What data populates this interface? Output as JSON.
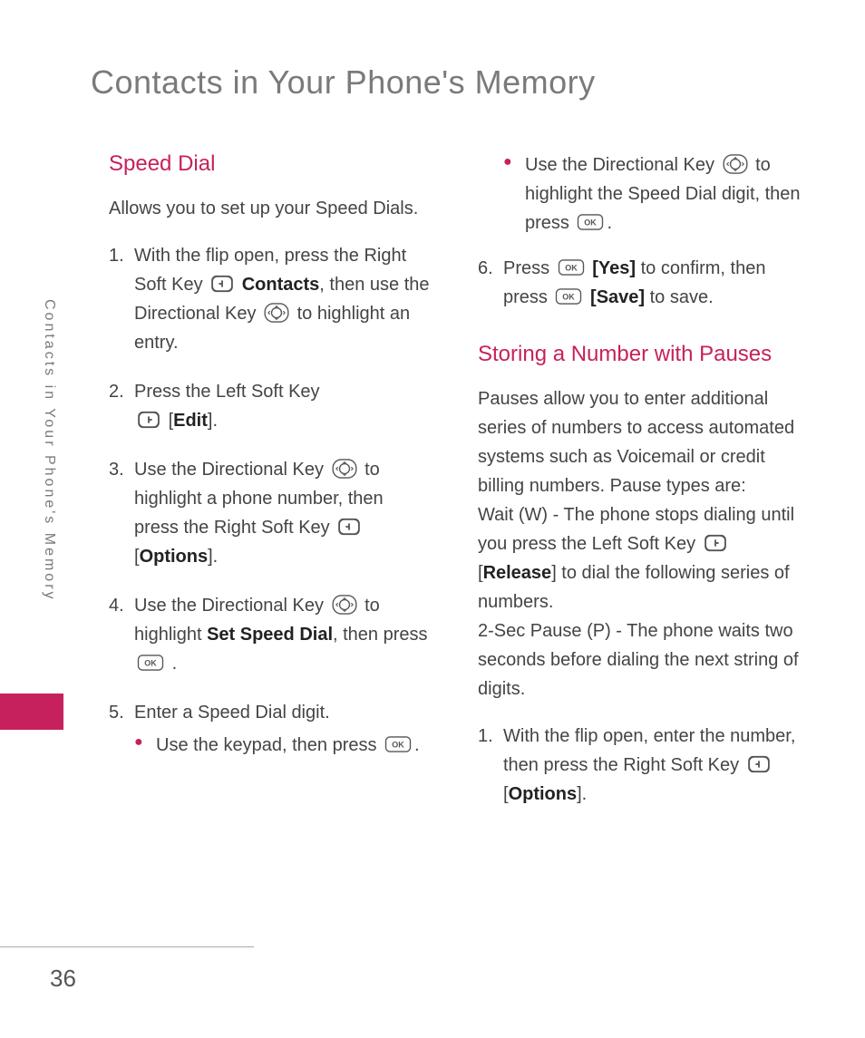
{
  "page_title": "Contacts in Your Phone's Memory",
  "side_tab": "Contacts in Your Phone's Memory",
  "page_number": "36",
  "left": {
    "heading": "Speed Dial",
    "intro": "Allows you to set up your Speed Dials.",
    "step1_a": "With the flip open, press the Right Soft Key ",
    "step1_b": "Contacts",
    "step1_c": ", then use the Directional Key ",
    "step1_d": " to highlight an entry.",
    "step2_a": "Press the Left Soft Key ",
    "step2_b": "[",
    "step2_c": "Edit",
    "step2_d": "].",
    "step3_a": "Use the Directional Key ",
    "step3_b": " to highlight a phone number, then press the Right Soft Key ",
    "step3_c": "[",
    "step3_d": "Options",
    "step3_e": "].",
    "step4_a": "Use the Directional Key ",
    "step4_b": " to highlight ",
    "step4_c": "Set Speed Dial",
    "step4_d": ", then press ",
    "step4_e": ".",
    "step5": "Enter a Speed Dial digit.",
    "step5_bul1_a": "Use the keypad, then press ",
    "step5_bul1_b": "."
  },
  "right": {
    "top_bul_a": "Use the Directional Key ",
    "top_bul_b": " to highlight the Speed Dial digit, then press ",
    "top_bul_c": ".",
    "step6_a": "Press ",
    "step6_b": "[Yes]",
    "step6_c": " to confirm, then press ",
    "step6_d": "[Save]",
    "step6_e": " to save.",
    "heading2": "Storing a Number with Pauses",
    "para_a": "Pauses allow you to enter additional series of numbers to access automated systems such as Voicemail or credit billing numbers. Pause types are:",
    "para_b1": "Wait (W) - The phone stops dialing until you press the Left Soft Key ",
    "para_b2": "[",
    "para_b3": "Release",
    "para_b4": "] to dial the following series of numbers.",
    "para_c": "2-Sec Pause (P) - The phone waits two seconds before dialing the next string of digits.",
    "r_step1_a": "With the flip open, enter the number, then press the Right Soft Key ",
    "r_step1_b": "[",
    "r_step1_c": "Options",
    "r_step1_d": "]."
  }
}
